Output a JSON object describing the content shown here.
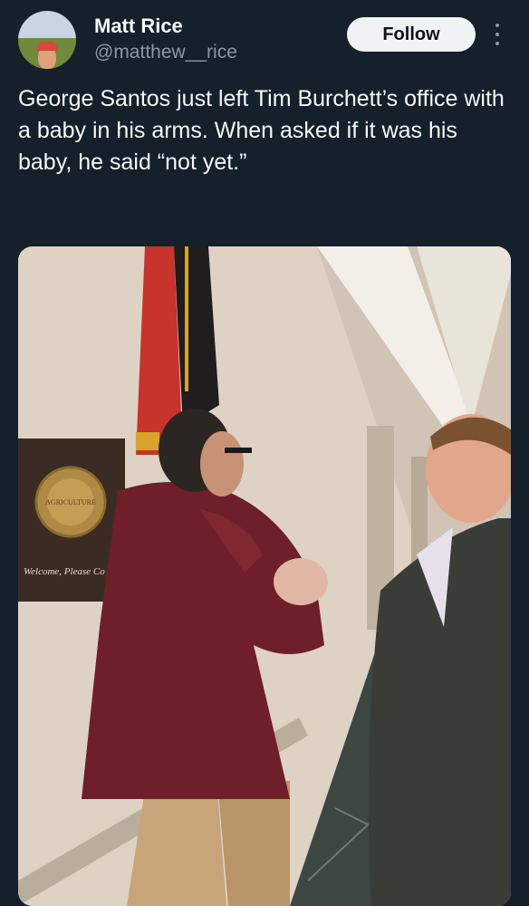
{
  "author": {
    "display_name": "Matt Rice",
    "handle": "@matthew__rice",
    "avatar_icon": "profile-avatar"
  },
  "actions": {
    "follow_label": "Follow",
    "more_icon": "more-options-icon"
  },
  "tweet": {
    "text": "George Santos just left Tim Burchett’s office with a baby in his arms. When asked if it was his baby, he said “not yet.”"
  },
  "media": {
    "plaque_text": "Welcome, Please Co",
    "seal_text": "AGRICULTURE"
  },
  "colors": {
    "background": "#15202b",
    "text_primary": "#f7f9f9",
    "text_secondary": "#8b98a5",
    "button_bg": "#eff3f4"
  }
}
